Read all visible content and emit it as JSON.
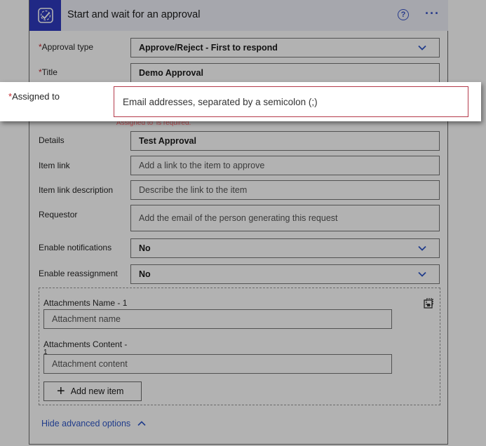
{
  "card": {
    "title": "Start and wait for an approval",
    "help_icon": "question-circle-icon",
    "more_icon": "ellipsis-icon",
    "app_icon": "approval-icon",
    "accent_color": "#2f3abf"
  },
  "fields": {
    "approval_type": {
      "label": "Approval type",
      "value": "Approve/Reject - First to respond"
    },
    "title": {
      "label": "Title",
      "value": "Demo Approval"
    },
    "details": {
      "label": "Details",
      "value": "Test Approval"
    },
    "item_link": {
      "label": "Item link",
      "placeholder": "Add a link to the item to approve"
    },
    "item_link_description": {
      "label": "Item link description",
      "placeholder": "Describe the link to the item"
    },
    "requestor": {
      "label": "Requestor",
      "placeholder": "Add the email of the person generating this request"
    },
    "enable_notifications": {
      "label": "Enable notifications",
      "value": "No"
    },
    "enable_reassignment": {
      "label": "Enable reassignment",
      "value": "No"
    }
  },
  "attachments": {
    "name_label": "Attachments Name - 1",
    "name_placeholder": "Attachment name",
    "content_label": "Attachments Content -",
    "content_label_cont": "1",
    "content_placeholder": "Attachment content",
    "add_item": "Add new item"
  },
  "advanced": {
    "hide_label": "Hide advanced options"
  },
  "popup": {
    "required_mark": "*",
    "label": "Assigned to",
    "placeholder": "Email addresses, separated by a semicolon (;)",
    "error_hint": "'Assigned to' is required."
  }
}
